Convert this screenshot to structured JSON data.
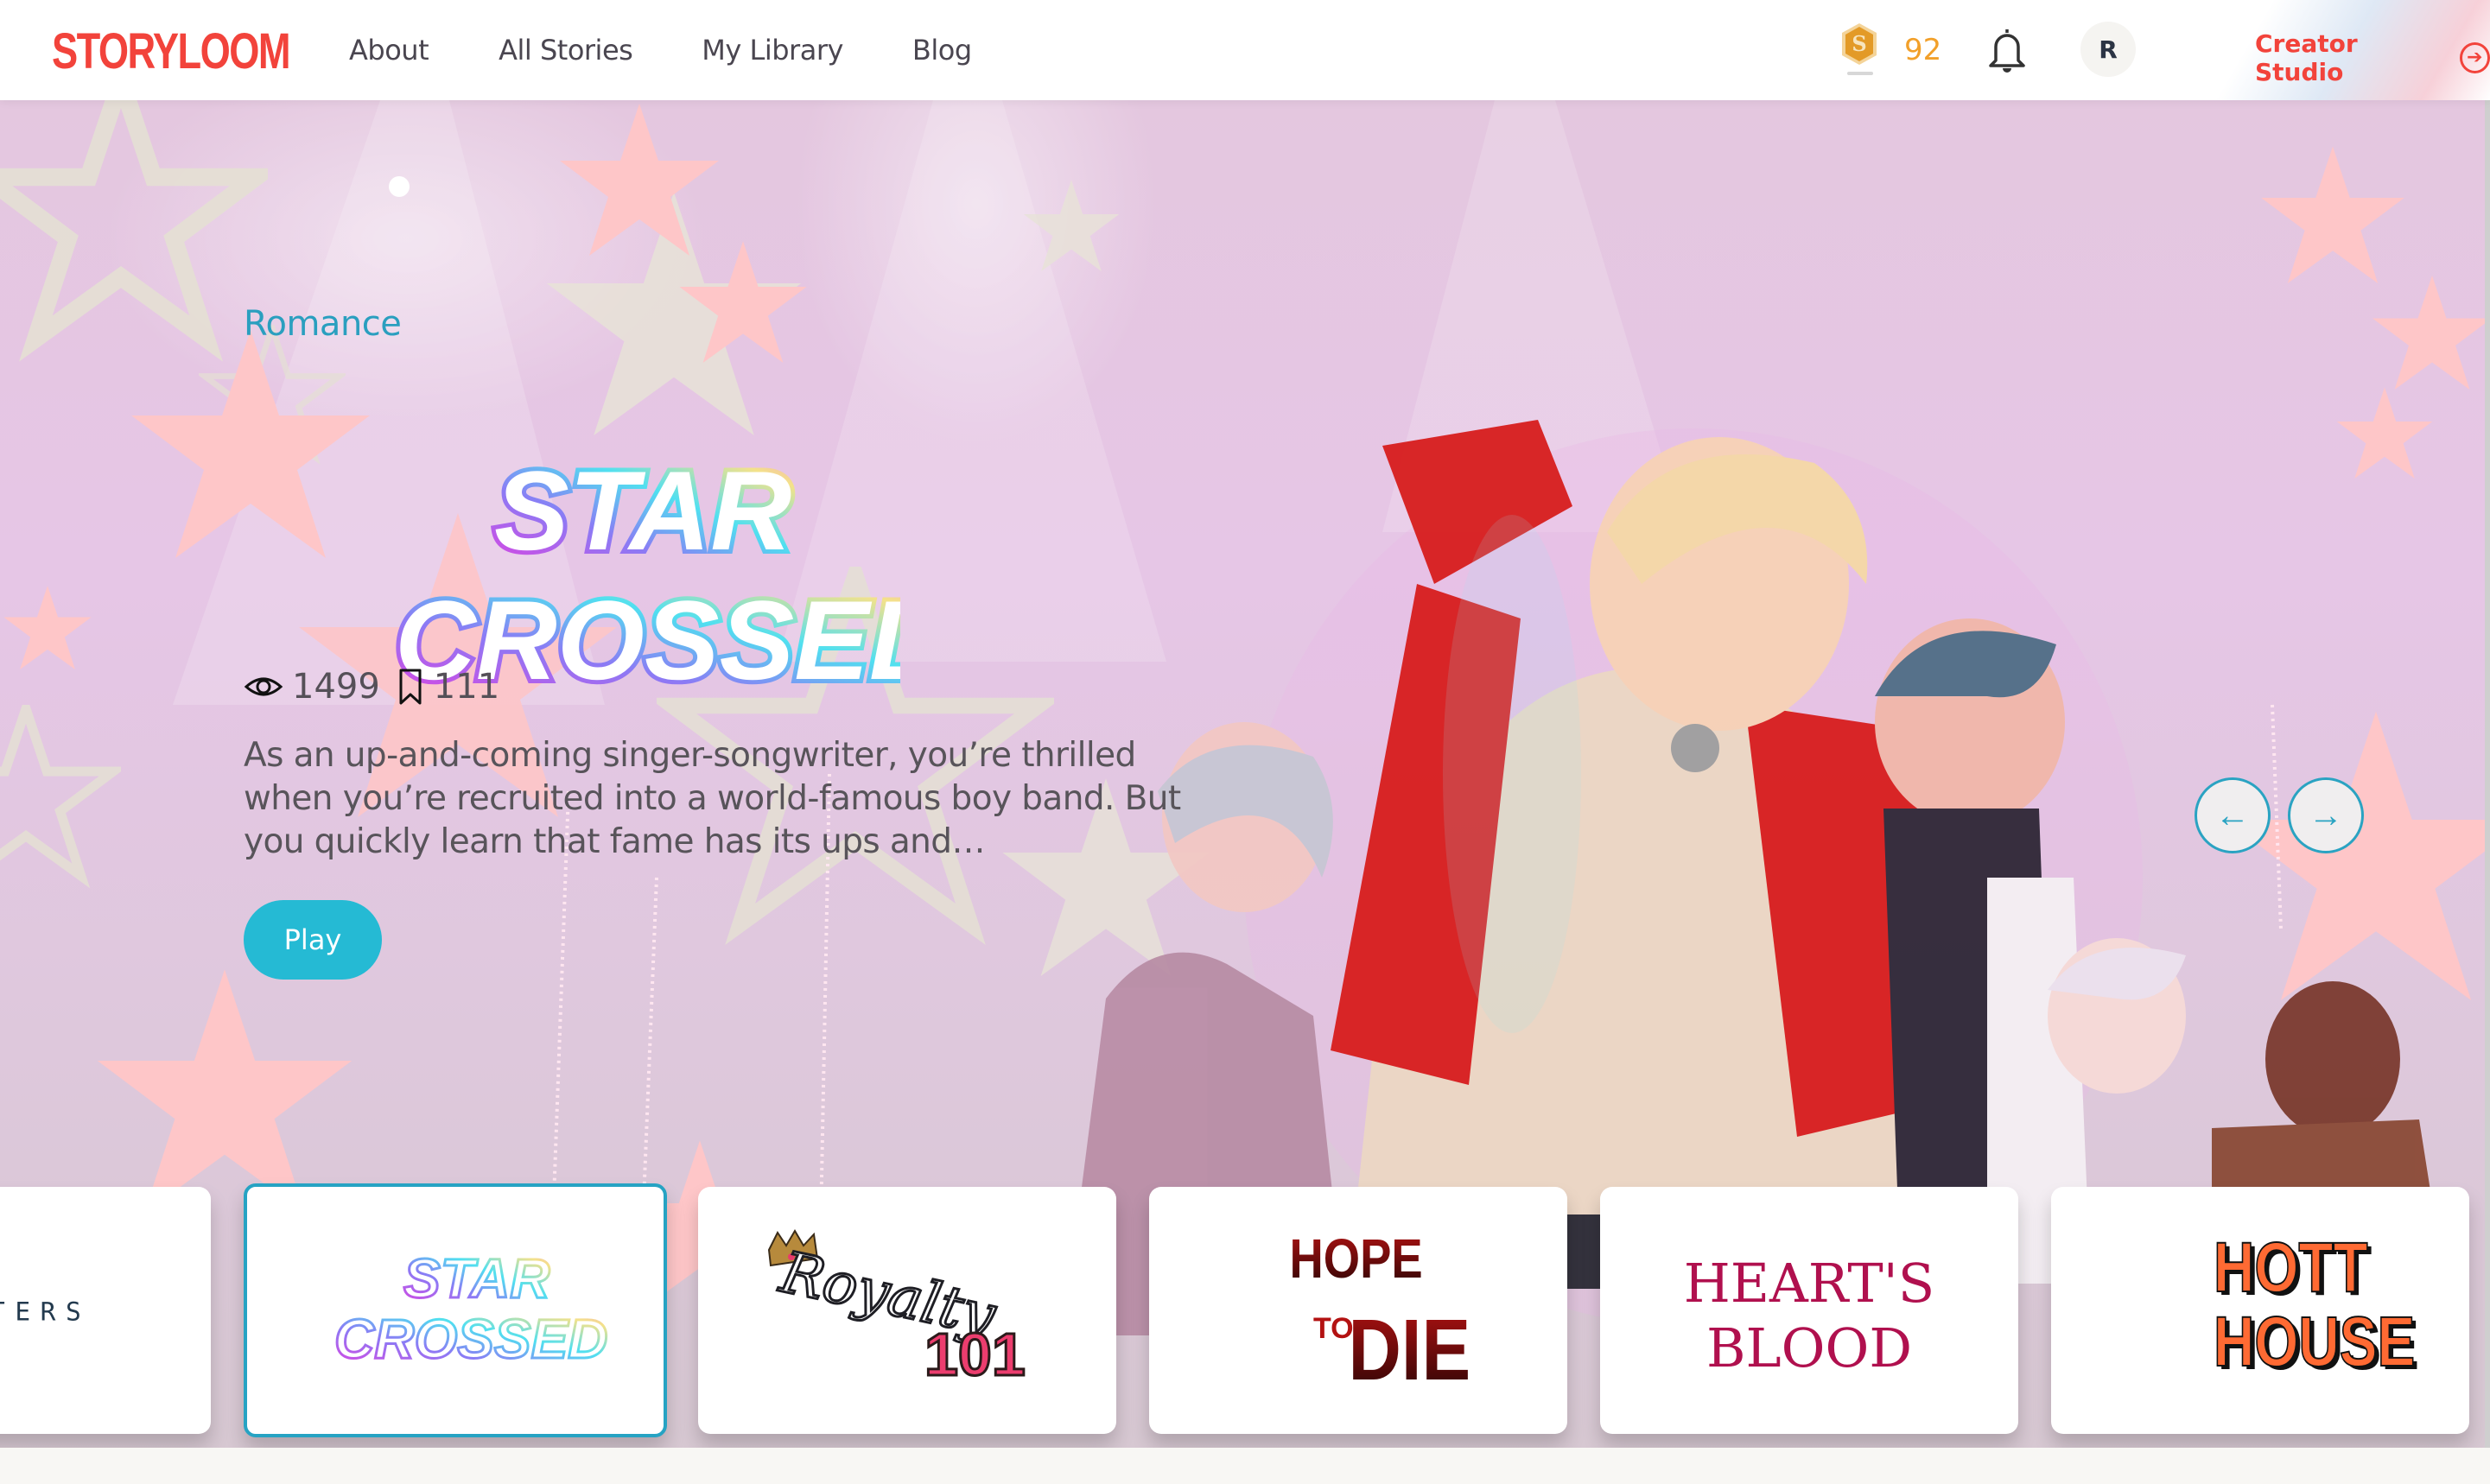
{
  "navbar": {
    "brand": "STORYLOOM",
    "links": [
      "About",
      "All Stories",
      "My Library",
      "Blog"
    ],
    "coins": {
      "icon": "coin-s-icon",
      "count": "92",
      "color": "#f2a02a"
    },
    "notifications_icon": "bell-icon",
    "avatar_initial": "R",
    "creator_studio": {
      "label": "Creator Studio",
      "icon": "arrow-right-circle-icon"
    },
    "brand_color": "#f2433b"
  },
  "hero": {
    "genre": "Romance",
    "title_line1": "STAR",
    "title_line2": "CROSSED",
    "views_icon": "eye-icon",
    "views": "1499",
    "bookmarks_icon": "bookmark-icon",
    "bookmarks": "111",
    "description": "As an up-and-coming singer-songwriter, you’re thrilled when you’re recruited into a world-famous boy band. But you quickly learn that fame has its ups and…",
    "play_label": "Play",
    "prev_arrow": "←",
    "next_arrow": "→",
    "accent_color": "#25bad4"
  },
  "carousel": {
    "items": [
      {
        "title": "WATERS",
        "active": false
      },
      {
        "title": "STAR CROSSED",
        "line1": "STAR",
        "line2": "CROSSED",
        "active": true
      },
      {
        "title": "Royalty 101",
        "line1": "Royalty",
        "line2": "101",
        "active": false
      },
      {
        "title": "HOPE TO DIE",
        "line1": "HOPE",
        "line2": "TO",
        "line3": "DIE",
        "active": false
      },
      {
        "title": "HEART'S BLOOD",
        "line1": "HEART'S",
        "line2": "BLOOD",
        "active": false
      },
      {
        "title": "HOTT HOUSE",
        "line1": "HOTT",
        "line2": "HOUSE",
        "active": false
      }
    ]
  }
}
